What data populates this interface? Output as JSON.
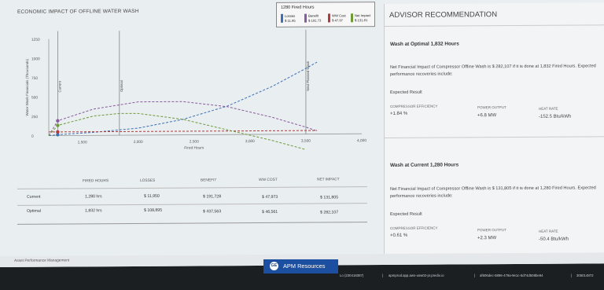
{
  "chart": {
    "title": "ECONOMIC IMPACT OF OFFLINE WATER WASH",
    "ylabel": "Water Wash Financials (Thousands)",
    "xlabel": "Fired Hours",
    "y_ticks": [
      "1250",
      "1000",
      "750",
      "500",
      "250",
      "0"
    ],
    "x_ticks": [
      "1,500",
      "2,000",
      "2,500",
      "3,000",
      "3,500",
      "4,000"
    ],
    "vline_labels": {
      "current": "Current",
      "optimal": "Optimal",
      "next_planned": "Next Planned Wash"
    },
    "colors": {
      "losses": "#3b6fb6",
      "benefit": "#8a5a9e",
      "ww_cost": "#b23a3a",
      "net_impact": "#6e9a3a"
    }
  },
  "chart_data": {
    "type": "line",
    "title": "ECONOMIC IMPACT OF OFFLINE WATER WASH",
    "xlabel": "Fired Hours",
    "ylabel": "Water Wash Financials (Thousands)",
    "xlim": [
      1200,
      4000
    ],
    "ylim": [
      0,
      1250
    ],
    "series": [
      {
        "name": "Losses",
        "x": [
          1200,
          1280,
          1600,
          2000,
          2400,
          2800,
          3200,
          3500,
          3600
        ],
        "y": [
          0,
          12,
          40,
          90,
          200,
          370,
          620,
          850,
          930
        ]
      },
      {
        "name": "Benefit",
        "x": [
          1200,
          1280,
          1600,
          2000,
          2400,
          2800,
          3200,
          3500,
          3600
        ],
        "y": [
          0,
          192,
          340,
          430,
          430,
          360,
          220,
          90,
          40
        ]
      },
      {
        "name": "WW Cost",
        "x": [
          1200,
          1280,
          1800,
          2400,
          3000,
          3500,
          3600
        ],
        "y": [
          48,
          48,
          47,
          47,
          46,
          46,
          46
        ]
      },
      {
        "name": "Net Impact",
        "x": [
          1200,
          1280,
          1600,
          1832,
          2000,
          2400,
          2800,
          3200,
          3500
        ],
        "y": [
          0,
          132,
          250,
          282,
          280,
          200,
          60,
          -80,
          -200
        ]
      }
    ],
    "vlines": [
      {
        "x": 1280,
        "label": "Current"
      },
      {
        "x": 1832,
        "label": "Optimal"
      },
      {
        "x": 3500,
        "label": "Next Planned Wash"
      }
    ],
    "grid": false
  },
  "tooltip": {
    "title": "1280 Fired Hours",
    "items": [
      {
        "label": "Losses",
        "value": "$ 11.95"
      },
      {
        "label": "Benefit",
        "value": "$ 191.73"
      },
      {
        "label": "WW Cost",
        "value": "$ 47.97"
      },
      {
        "label": "Net Impact",
        "value": "$ 131.81"
      }
    ]
  },
  "table": {
    "headers": [
      "FIRED HOURS",
      "LOSSES",
      "BENEFIT",
      "WW COST",
      "NET IMPACT"
    ],
    "rows": [
      {
        "label": "Current",
        "fired_hours": "1,280 hrs",
        "losses": "$ 11,950",
        "benefit": "$ 191,728",
        "ww_cost": "$ 47,973",
        "net_impact": "$ 131,805"
      },
      {
        "label": "Optimal",
        "fired_hours": "1,832 hrs",
        "losses": "$ 108,895",
        "benefit": "$ 437,563",
        "ww_cost": "$ 46,561",
        "net_impact": "$ 282,107"
      }
    ]
  },
  "advisor": {
    "title": "ADVISOR RECOMMENDATION",
    "optimal": {
      "heading": "Wash at Optimal 1,832 Hours",
      "text": "Net Financial Impact of Compressor Offline Wash is $ 282,107 if it is done at 1,832 Fired Hours. Expected performance recoveries include:",
      "expected_label": "Expected Result",
      "metrics": [
        {
          "label": "COMPRESSOR EFFICIENCY",
          "value": "+1.84 %"
        },
        {
          "label": "POWER OUTPUT",
          "value": "+6.8 MW"
        },
        {
          "label": "HEAT RATE",
          "value": "-152.5 Btu/kWh"
        }
      ]
    },
    "current": {
      "heading": "Wash at Current 1,280 Hours",
      "text": "Net Financial Impact of Compressor Offline Wash is $ 131,805 if it is done at 1,280 Fired Hours. Expected performance recoveries include:",
      "expected_label": "Expected Result",
      "metrics": [
        {
          "label": "COMPRESSOR EFFICIENCY",
          "value": "+0.61 %"
        },
        {
          "label": "POWER OUTPUT",
          "value": "+2.3 MW"
        },
        {
          "label": "HEAT RATE",
          "value": "-50.4 Btu/kWh"
        }
      ]
    }
  },
  "footer": {
    "left_text": "Asset Performance Management",
    "apm_button": "APM Resources",
    "apm_logo": "GE",
    "status_items": [
      "Lo (230418387)",
      "apmprod.app.aws-usw02-pr.predix.io",
      "af606dec-5896-479a-9e1c-5d74d508be94",
      "305014872"
    ]
  }
}
